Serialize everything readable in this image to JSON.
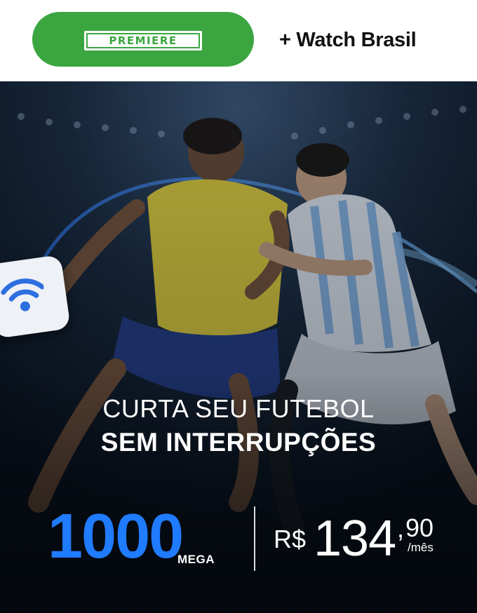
{
  "header": {
    "premiere_logo_text": "PREMIERE",
    "addon_label": "+ Watch Brasil"
  },
  "hero": {
    "headline_line1": "CURTA SEU FUTEBOL",
    "headline_line2": "SEM INTERRUPÇÕES",
    "speed_value": "1000",
    "speed_unit": "MEGA",
    "price_currency": "R$",
    "price_integer": "134",
    "price_separator": ",",
    "price_cents": "90",
    "price_period": "/mês"
  },
  "colors": {
    "premiere_green": "#3ba63f",
    "speed_blue": "#1f7bff",
    "hero_background": "#0c1624"
  },
  "icons": {
    "wifi_badge": "wifi-icon"
  }
}
